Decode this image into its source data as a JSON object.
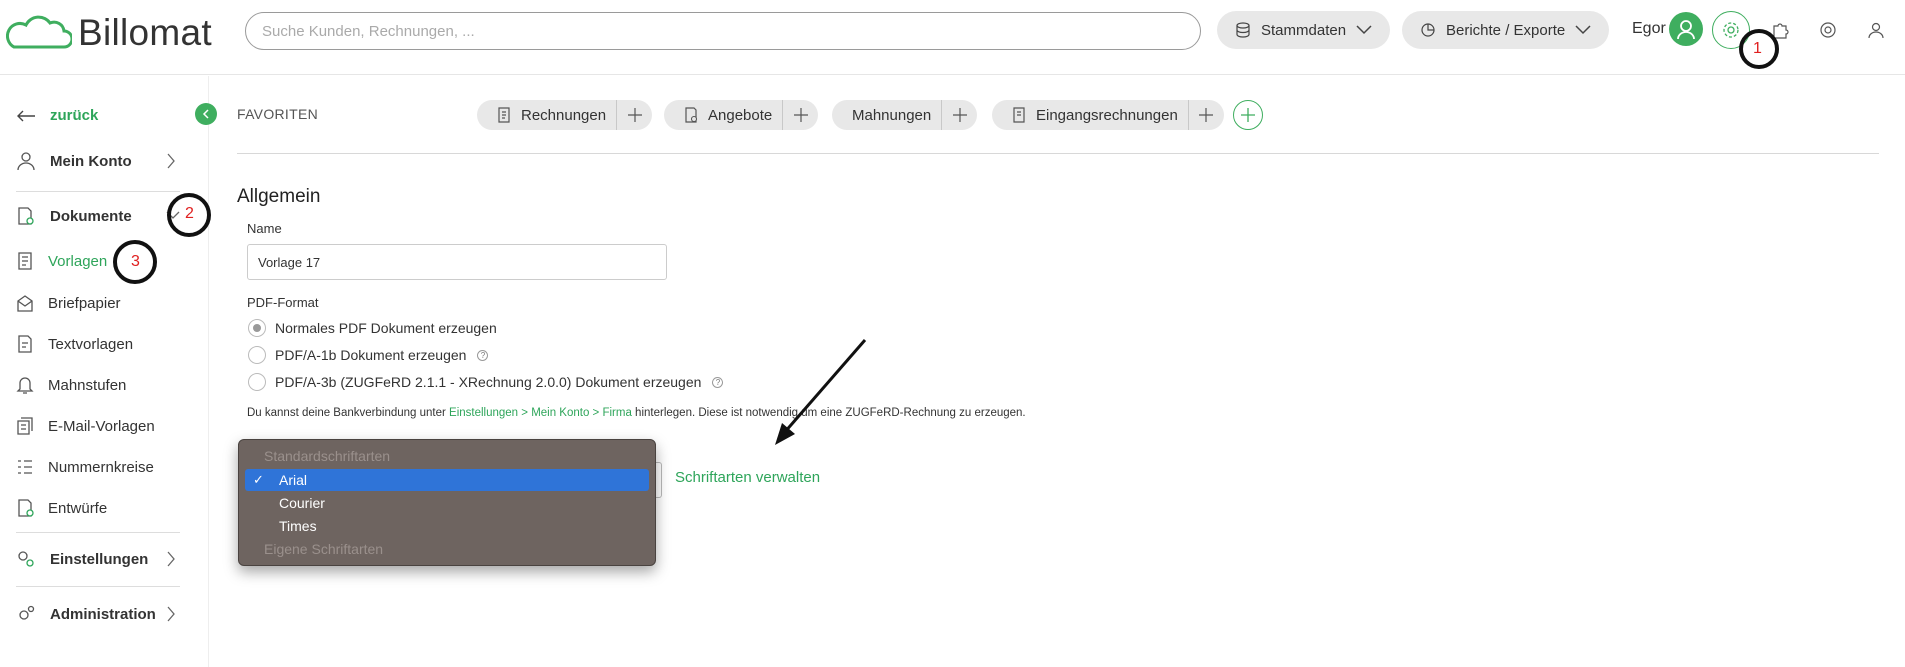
{
  "app": {
    "name": "Billomat"
  },
  "header": {
    "search_placeholder": "Suche Kunden, Rechnungen, ...",
    "menu_stammdaten": "Stammdaten",
    "menu_berichte": "Berichte / Exporte",
    "user_name": "Egor"
  },
  "annotations": {
    "one": "1",
    "two": "2",
    "three": "3"
  },
  "sidebar": {
    "back": "zurück",
    "mein_konto": "Mein Konto",
    "dokumente": "Dokumente",
    "items": [
      "Vorlagen",
      "Briefpapier",
      "Textvorlagen",
      "Mahnstufen",
      "E-Mail-Vorlagen",
      "Nummernkreise",
      "Entwürfe"
    ],
    "einstellungen": "Einstellungen",
    "administration": "Administration"
  },
  "favorites": {
    "label": "FAVORITEN",
    "items": [
      "Rechnungen",
      "Angebote",
      "Mahnungen",
      "Eingangsrechnungen"
    ]
  },
  "form": {
    "section_title": "Allgemein",
    "name_label": "Name",
    "name_value": "Vorlage 17",
    "pdf_label": "PDF-Format",
    "pdf_options": [
      "Normales PDF Dokument erzeugen",
      "PDF/A-1b Dokument erzeugen",
      "PDF/A-3b (ZUGFeRD 2.1.1 - XRechnung 2.0.0) Dokument erzeugen"
    ],
    "note_prefix": "Du kannst deine Bankverbindung unter ",
    "note_link": "Einstellungen > Mein Konto > Firma",
    "note_suffix": " hinterlegen. Diese ist notwendig um eine ZUGFeRD-Rechnung zu erzeugen.",
    "manage_fonts": "Schriftarten verwalten"
  },
  "font_dropdown": {
    "group_standard": "Standardschriftarten",
    "options": [
      "Arial",
      "Courier",
      "Times"
    ],
    "selected": "Arial",
    "group_custom": "Eigene Schriftarten"
  },
  "colors": {
    "accent": "#2ea55a",
    "select_highlight": "#2f74d8",
    "dropdown_bg": "#6e6460"
  }
}
